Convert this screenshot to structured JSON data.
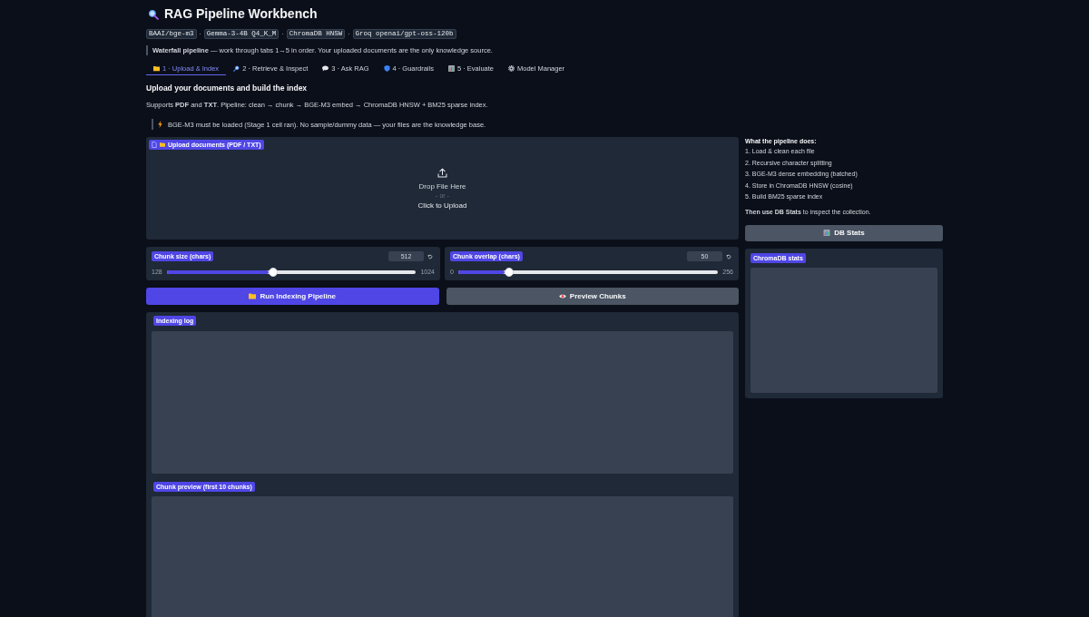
{
  "header": {
    "title": "RAG Pipeline Workbench",
    "badges": [
      "BAAI/bge-m3",
      "Gemma-3-4B Q4_K_M",
      "ChromaDB HNSW",
      "Groq openai/gpt-oss-120b"
    ],
    "separator": "·"
  },
  "notice": "**Waterfall pipeline** — work through tabs 1→5 in order. Your uploaded documents are the only knowledge source.",
  "tabs": [
    {
      "label": "1 · Upload & Index",
      "selected": true
    },
    {
      "label": "2 · Retrieve & Inspect",
      "selected": false
    },
    {
      "label": "3 · Ask RAG",
      "selected": false
    },
    {
      "label": "4 · Guardrails",
      "selected": false
    },
    {
      "label": "5 · Evaluate",
      "selected": false
    },
    {
      "label": "Model Manager",
      "selected": false
    }
  ],
  "section": {
    "heading": "Upload your documents and build the index",
    "intro": "Supports **PDF** and **TXT**. Pipeline: clean → chunk → BGE-M3 embed → ChromaDB HNSW + BM25 sparse index.",
    "warning": "BGE-M3 must be loaded (Stage 1 cell ran). No sample/dummy data — your files are the knowledge base."
  },
  "upload": {
    "label": "Upload documents (PDF / TXT)",
    "drop_text": "Drop File Here",
    "or_text": "- or -",
    "click_text": "Click to Upload"
  },
  "sliders": [
    {
      "label": "Chunk size (chars)",
      "value": "512",
      "min": "128",
      "max": "1024",
      "level": 0.4286
    },
    {
      "label": "Chunk overlap (chars)",
      "value": "50",
      "min": "0",
      "max": "256",
      "level": 0.1953
    }
  ],
  "actions": [
    {
      "label": "Run Indexing Pipeline",
      "kind": "primary"
    },
    {
      "label": "Preview Chunks",
      "kind": "secondary"
    }
  ],
  "outputs": [
    {
      "label": "Indexing log"
    },
    {
      "label": "Chunk preview (first 10 chunks)"
    }
  ],
  "sidebar": {
    "heading": "What the pipeline does:",
    "steps": [
      "1. Load & clean each file",
      "2. Recursive character splitting",
      "3. BGE-M3 dense embedding (batched)",
      "4. Store in ChromaDB HNSW (cosine)",
      "5. Build BM25 sparse index"
    ],
    "note": "**Then use DB Stats** to inspect the collection.",
    "button": {
      "label": "DB Stats",
      "kind": "secondary"
    },
    "stats_panel": {
      "label": "ChromaDB stats"
    }
  }
}
